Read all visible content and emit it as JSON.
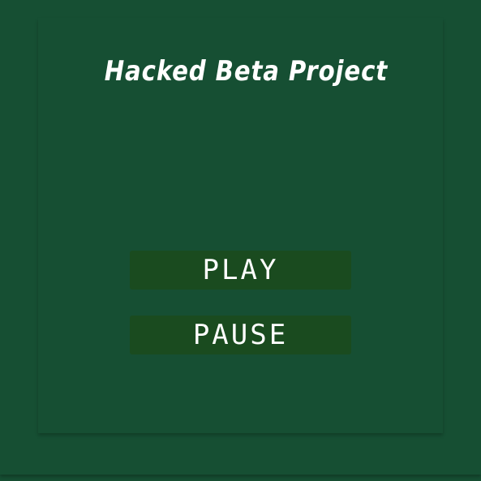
{
  "game": {
    "title": "Hacked Beta Project",
    "buttons": {
      "play_label": "PLAY",
      "pause_label": "PAUSE"
    }
  },
  "colors": {
    "background": "#164f33",
    "button_background": "#1a4b1f",
    "text": "#ffffff"
  }
}
